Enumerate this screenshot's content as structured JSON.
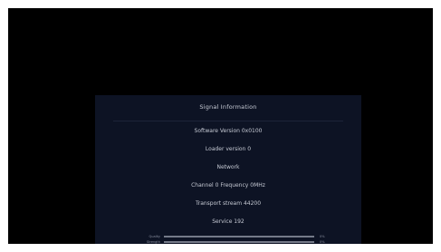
{
  "signal_info": {
    "title": "Signal Information",
    "software_version": "Software Version 0x0100",
    "loader_version": "Loader version 0",
    "network": "Network",
    "channel_frequency": "Channel 0 Frequency 0MHz",
    "transport_stream": "Transport stream 44200",
    "service": "Service 192"
  },
  "meters": {
    "quality": {
      "label": "Quality",
      "value_text": "0%",
      "level_percent": 0
    },
    "strength": {
      "label": "Strength",
      "value_text": "0%",
      "level_percent": 0
    }
  }
}
